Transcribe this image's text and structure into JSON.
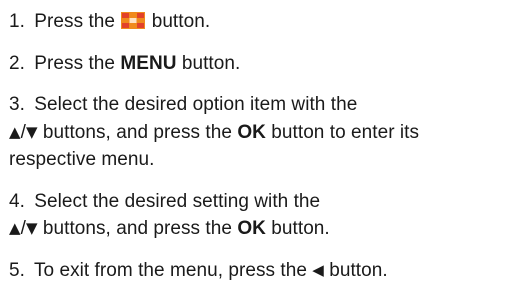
{
  "steps": [
    {
      "num": "1.",
      "t1": "Press the",
      "t2": "button.",
      "icon": "colored-grid-icon"
    },
    {
      "num": "2.",
      "t1": "Press the",
      "b1": "MENU",
      "t2": "button."
    },
    {
      "num": "3.",
      "t1": "Select the desired option item with the",
      "up": "▲",
      "slash": "/",
      "down": "▼",
      "t2": "buttons, and press the",
      "b1": "OK",
      "t3": "button to enter its respective menu."
    },
    {
      "num": "4.",
      "t1": "Select the desired setting with the",
      "up": "▲",
      "slash": "/",
      "down": "▼",
      "t2": "buttons, and press the",
      "b1": "OK",
      "t3": "button."
    },
    {
      "num": "5.",
      "t1": "To exit from the menu, press the",
      "left": "◀",
      "t2": "button."
    }
  ],
  "colors": {
    "icon_orange": "#f08a1c",
    "icon_red": "#e2412a",
    "icon_light": "#ffe2c4",
    "text": "#1a1a1a"
  }
}
